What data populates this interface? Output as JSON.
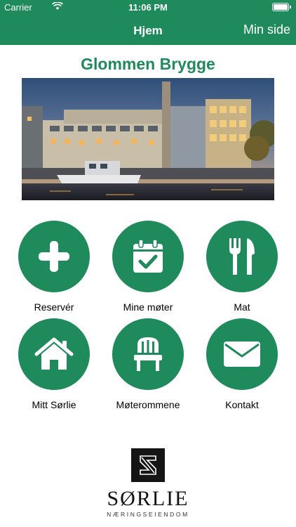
{
  "status_bar": {
    "carrier": "Carrier",
    "time": "11:06 PM"
  },
  "nav": {
    "title": "Hjem",
    "right_label": "Min side"
  },
  "page": {
    "title": "Glommen Brygge"
  },
  "hero": {
    "image": "waterfront-building-photo"
  },
  "grid": [
    {
      "label": "Reservér",
      "icon": "plus-icon"
    },
    {
      "label": "Mine møter",
      "icon": "calendar-check-icon"
    },
    {
      "label": "Mat",
      "icon": "fork-knife-icon"
    },
    {
      "label": "Mitt Sørlie",
      "icon": "home-icon"
    },
    {
      "label": "Møterommene",
      "icon": "chair-icon"
    },
    {
      "label": "Kontakt",
      "icon": "envelope-icon"
    }
  ],
  "brand": {
    "name": "SØRLIE",
    "tagline": "NÆRINGSEIENDOM"
  },
  "colors": {
    "primary": "#1f8a5c"
  }
}
